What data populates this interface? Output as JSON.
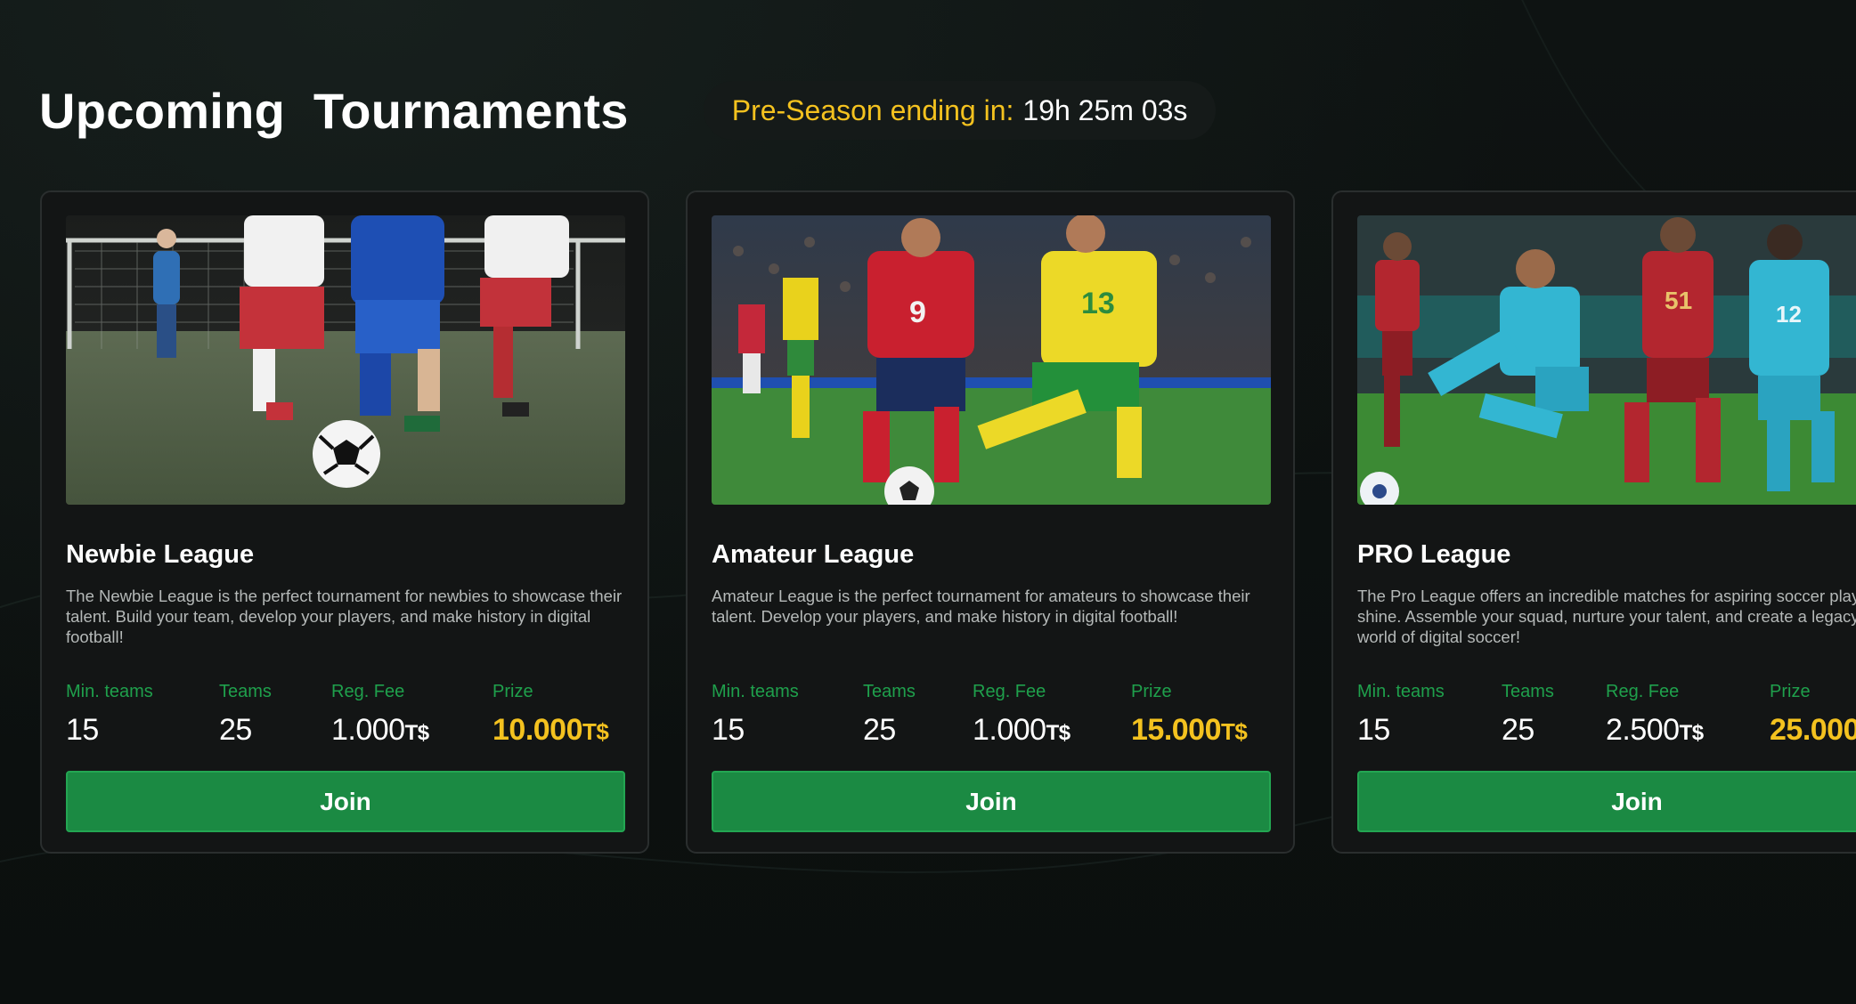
{
  "header": {
    "title": "Upcoming  Tournaments",
    "countdown_label": "Pre-Season ending in:",
    "countdown_value": "19h 25m 03s"
  },
  "currency_unit": "T$",
  "stat_labels": {
    "min_teams": "Min. teams",
    "teams": "Teams",
    "reg_fee": "Reg. Fee",
    "prize": "Prize"
  },
  "cards": [
    {
      "title": "Newbie League",
      "description": "The Newbie League is the perfect tournament for newbies to showcase their talent. Build your team, develop your players, and make history in digital football!",
      "min_teams": "15",
      "teams": "25",
      "reg_fee": "1.000",
      "prize": "10.000",
      "button_label": "Join",
      "image_icon": "youth-soccer-photo"
    },
    {
      "title": "Amateur League",
      "description": "Amateur League is the perfect tournament for amateurs to showcase their talent. Develop your players, and make history in digital football!",
      "min_teams": "15",
      "teams": "25",
      "reg_fee": "1.000",
      "prize": "15.000",
      "button_label": "Join",
      "image_icon": "stadium-soccer-photo"
    },
    {
      "title": "PRO League",
      "description": "The Pro League offers an incredible matches for aspiring soccer players to shine. Assemble your squad, nurture your talent, and create a legacy in the world of digital soccer!",
      "min_teams": "15",
      "teams": "25",
      "reg_fee": "2.500",
      "prize": "25.000",
      "button_label": "Join",
      "image_icon": "pro-soccer-photo"
    }
  ],
  "colors": {
    "background": "#0d1110",
    "card": "#131515",
    "accent_green": "#1b8a43",
    "label_green": "#1fa04c",
    "prize_gold": "#f4c21f"
  }
}
